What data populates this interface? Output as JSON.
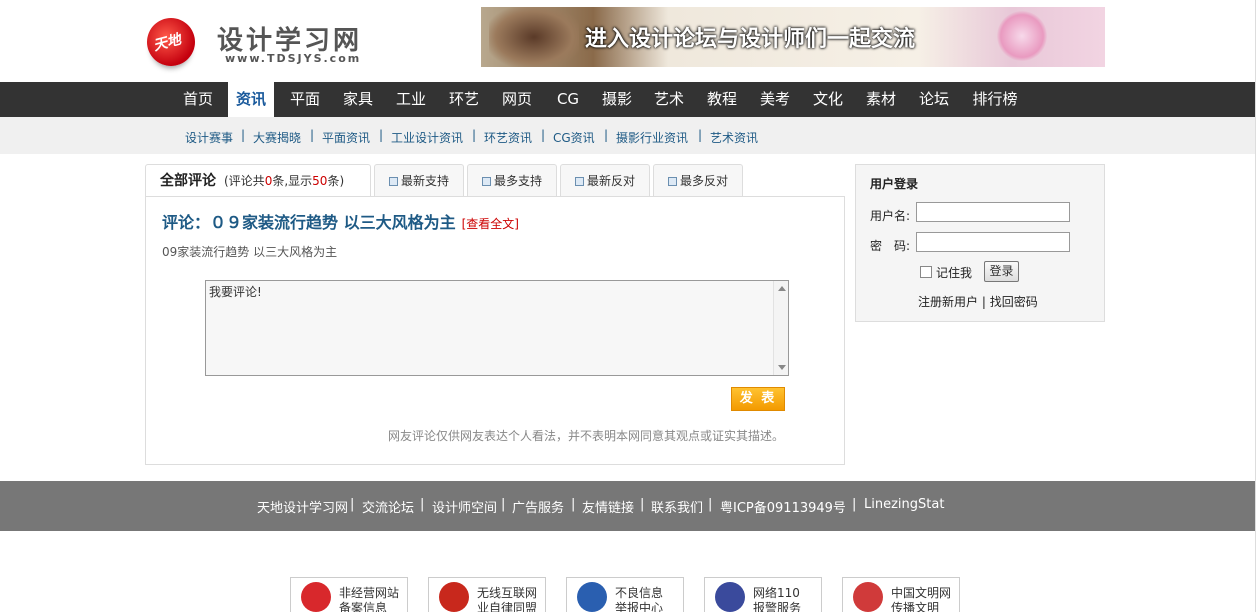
{
  "logo": {
    "seal_text": "天地",
    "name": "设计学习网",
    "url": "www.TDSJYS.com"
  },
  "banner": {
    "text": "进入设计论坛与设计师们一起交流"
  },
  "nav": {
    "items": [
      "首页",
      "资讯",
      "平面",
      "家具",
      "工业",
      "环艺",
      "网页",
      "CG",
      "摄影",
      "艺术",
      "教程",
      "美考",
      "文化",
      "素材",
      "论坛",
      "排行榜"
    ],
    "active_index": 1
  },
  "subnav": {
    "items": [
      "设计赛事",
      "大赛揭晓",
      "平面资讯",
      "工业设计资讯",
      "环艺资讯",
      "CG资讯",
      "摄影行业资讯",
      "艺术资讯"
    ],
    "separator": "|"
  },
  "tabs": {
    "all": {
      "label": "全部评论",
      "count_prefix": "(评论共",
      "count": "0",
      "count_mid": "条,显示",
      "shown": "50",
      "count_suffix": "条)"
    },
    "others": [
      "最新支持",
      "最多支持",
      "最新反对",
      "最多反对"
    ]
  },
  "article": {
    "title_prefix": "评论：",
    "title": "０９家装流行趋势 以三大风格为主",
    "view_full": "[查看全文]",
    "subtitle": "09家装流行趋势 以三大风格为主"
  },
  "comment": {
    "placeholder": "我要评论!",
    "post_label": "发 表",
    "disclaimer": "网友评论仅供网友表达个人看法，并不表明本网同意其观点或证实其描述。"
  },
  "login": {
    "title": "用户登录",
    "username_label": "用户名:",
    "password_label": "密　码:",
    "remember_label": "记住我",
    "login_button": "登录",
    "register_link": "注册新用户",
    "separator": "|",
    "forgot_link": "找回密码"
  },
  "footer": {
    "links": [
      "天地设计学习网",
      "交流论坛",
      "设计师空间",
      "广告服务",
      "友情链接",
      "联系我们",
      "粤ICP备09113949号",
      "LinezingStat"
    ],
    "separator": "|"
  },
  "badges": [
    {
      "line1": "非经营网站",
      "line2": "备案信息",
      "color": "#d8282c"
    },
    {
      "line1": "无线互联网",
      "line2": "业自律同盟",
      "color": "#c8281c"
    },
    {
      "line1": "不良信息",
      "line2": "举报中心",
      "color": "#2a5fb0"
    },
    {
      "line1": "网络110",
      "line2": "报警服务",
      "color": "#3a4a9c"
    },
    {
      "line1": "中国文明网",
      "line2": "传播文明",
      "color": "#d03a3a"
    }
  ]
}
